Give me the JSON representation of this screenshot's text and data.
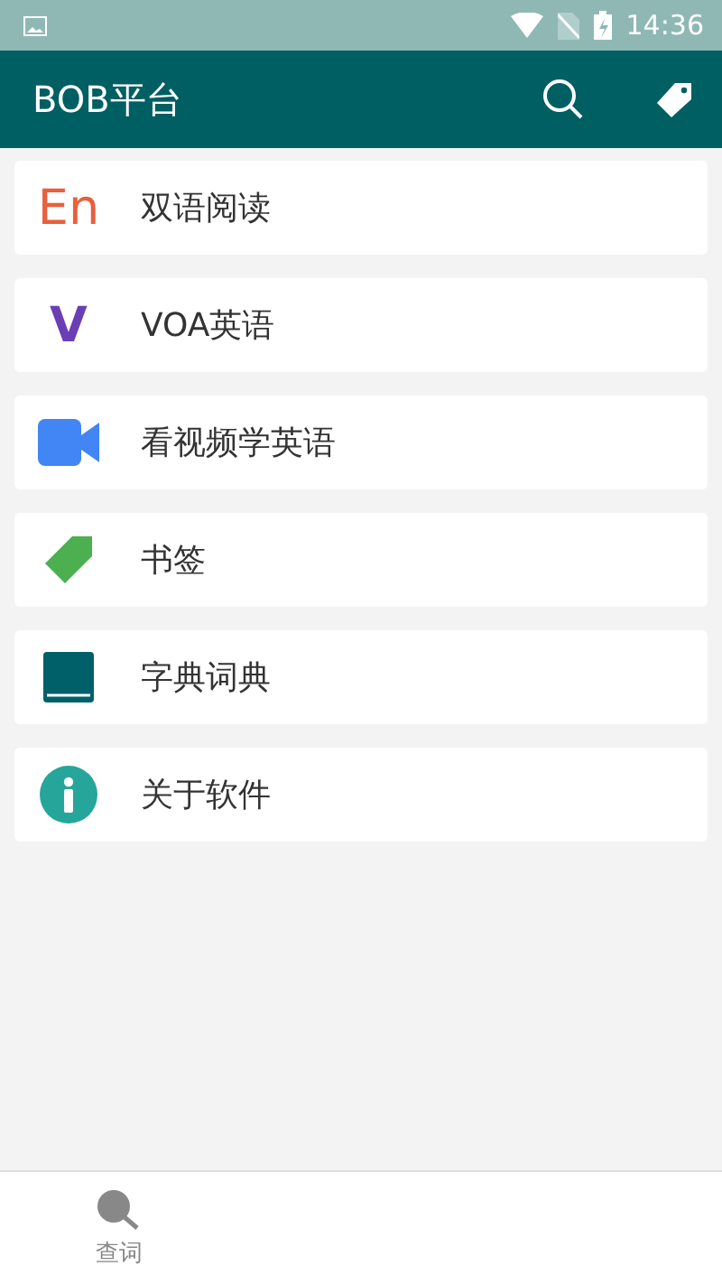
{
  "status_bar": {
    "time": "14:36"
  },
  "app_bar": {
    "title": "BOB平台"
  },
  "menu": [
    {
      "label": "双语阅读",
      "kind": "text",
      "glyph": "En",
      "color": "#e8603c"
    },
    {
      "label": "VOA英语",
      "kind": "text",
      "glyph": "V",
      "color": "#6a3fb5"
    },
    {
      "label": "看视频学英语",
      "kind": "video",
      "color": "#4285f4"
    },
    {
      "label": "书签",
      "kind": "tag",
      "color": "#4caf50"
    },
    {
      "label": "字典词典",
      "kind": "book",
      "color": "#00606a"
    },
    {
      "label": "关于软件",
      "kind": "info",
      "color": "#26a69a"
    }
  ],
  "bottom_nav": [
    {
      "label": "查词",
      "selected": false
    }
  ]
}
